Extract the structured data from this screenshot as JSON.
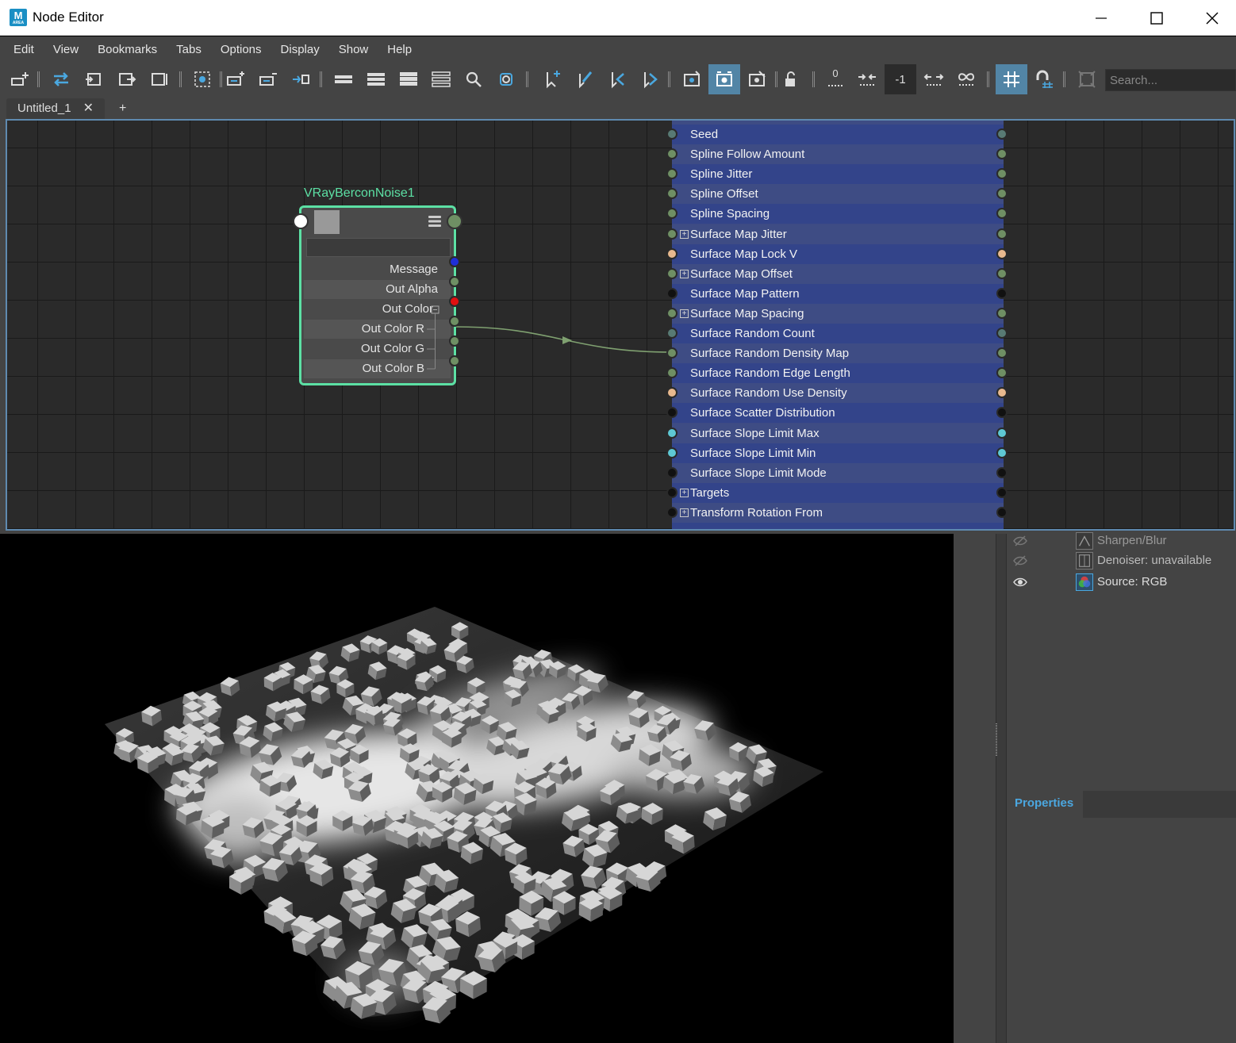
{
  "window": {
    "title": "Node Editor",
    "app_icon_letter": "M",
    "app_icon_sub": "AREA"
  },
  "menu": [
    "Edit",
    "View",
    "Bookmarks",
    "Tabs",
    "Options",
    "Display",
    "Show",
    "Help"
  ],
  "toolbar": {
    "num_zero": "0",
    "num_minus_one": "-1",
    "search_placeholder": "Search..."
  },
  "tabs": {
    "active": "Untitled_1",
    "close": "✕",
    "add": "+"
  },
  "node": {
    "title": "VRayBerconNoise1",
    "ports": [
      {
        "label": "Message",
        "color": "#1f2fd8"
      },
      {
        "label": "Out Alpha",
        "color": "#6f8f64"
      },
      {
        "label": "Out Color",
        "color": "#e01010"
      },
      {
        "label": "Out Color R",
        "color": "#6f8f64"
      },
      {
        "label": "Out Color G",
        "color": "#6f8f64"
      },
      {
        "label": "Out Color B",
        "color": "#6f8f64"
      }
    ]
  },
  "attributes": [
    {
      "label": "Seed",
      "expand": false,
      "color": "#587a74"
    },
    {
      "label": "Spline Follow Amount",
      "expand": false,
      "color": "#6f8f64"
    },
    {
      "label": "Spline Jitter",
      "expand": false,
      "color": "#6f8f64"
    },
    {
      "label": "Spline Offset",
      "expand": false,
      "color": "#6f8f64"
    },
    {
      "label": "Spline Spacing",
      "expand": false,
      "color": "#6f8f64"
    },
    {
      "label": "Surface Map Jitter",
      "expand": true,
      "color": "#6f8f64"
    },
    {
      "label": "Surface Map Lock V",
      "expand": false,
      "color": "#e8b98e"
    },
    {
      "label": "Surface Map Offset",
      "expand": true,
      "color": "#6f8f64"
    },
    {
      "label": "Surface Map Pattern",
      "expand": false,
      "color": "#111111"
    },
    {
      "label": "Surface Map Spacing",
      "expand": true,
      "color": "#6f8f64"
    },
    {
      "label": "Surface Random Count",
      "expand": false,
      "color": "#587a74"
    },
    {
      "label": "Surface Random Density Map",
      "expand": false,
      "color": "#6f8f64"
    },
    {
      "label": "Surface Random Edge Length",
      "expand": false,
      "color": "#6f8f64"
    },
    {
      "label": "Surface Random Use Density",
      "expand": false,
      "color": "#e8b98e"
    },
    {
      "label": "Surface Scatter Distribution",
      "expand": false,
      "color": "#111111"
    },
    {
      "label": "Surface Slope Limit Max",
      "expand": false,
      "color": "#5ec8d4"
    },
    {
      "label": "Surface Slope Limit Min",
      "expand": false,
      "color": "#5ec8d4"
    },
    {
      "label": "Surface Slope Limit Mode",
      "expand": false,
      "color": "#111111"
    },
    {
      "label": "Targets",
      "expand": true,
      "color": "#111111"
    },
    {
      "label": "Transform Rotation From",
      "expand": true,
      "color": "#111111"
    }
  ],
  "layers": [
    {
      "label": "Sharpen/Blur"
    },
    {
      "label": "Denoiser: unavailable"
    },
    {
      "label": "Source: RGB"
    }
  ],
  "properties": {
    "title": "Properties"
  }
}
